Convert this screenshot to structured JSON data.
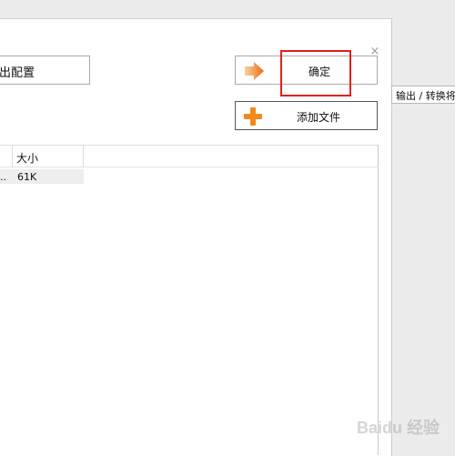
{
  "dialog": {
    "close_glyph": "×",
    "config_button_label": "出配置",
    "ok_button_label": "确定",
    "add_file_button_label": "添加文件"
  },
  "tooltip": {
    "text": "输出 / 转换将"
  },
  "file_list": {
    "columns": [
      "",
      "大小"
    ],
    "rows": [
      {
        "name": "..",
        "size": "61K"
      }
    ]
  },
  "watermark": {
    "text": "Baidu 经验"
  },
  "colors": {
    "highlight": "#e0201b",
    "arrow_icon": "#f07a1a",
    "plus_icon": "#f28a1e"
  },
  "icons": {
    "ok": "orange-arrow-icon",
    "add": "orange-plus-icon"
  }
}
